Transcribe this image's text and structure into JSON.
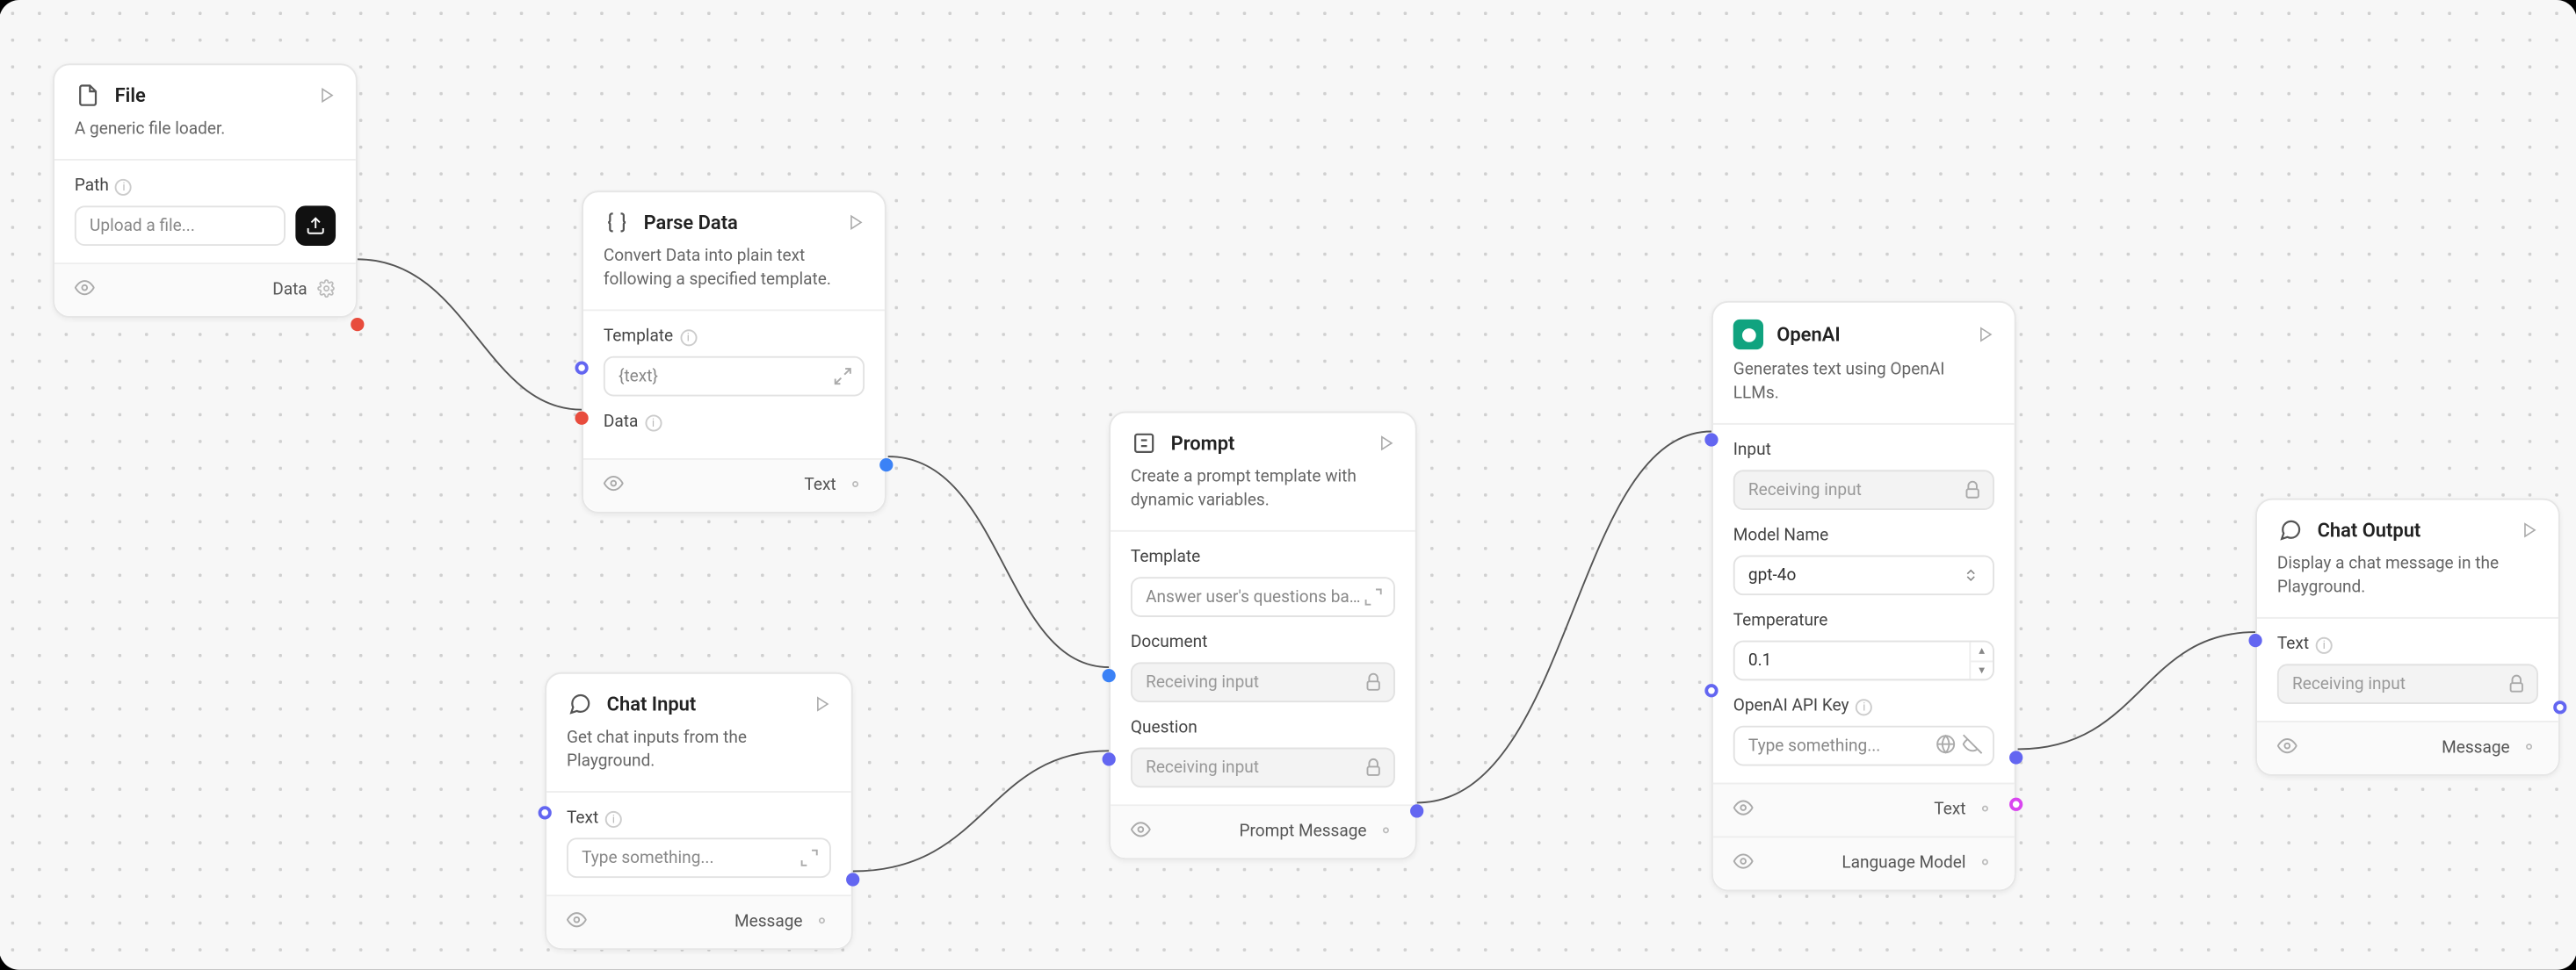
{
  "nodes": {
    "file": {
      "title": "File",
      "desc": "A generic file loader.",
      "path_label": "Path",
      "path_placeholder": "Upload a file...",
      "output_label": "Data"
    },
    "parse": {
      "title": "Parse Data",
      "desc": "Convert Data into plain text following a specified template.",
      "template_label": "Template",
      "template_value": "{text}",
      "data_label": "Data",
      "output_label": "Text"
    },
    "chat_input": {
      "title": "Chat Input",
      "desc": "Get chat inputs from the Playground.",
      "text_label": "Text",
      "text_placeholder": "Type something...",
      "output_label": "Message"
    },
    "prompt": {
      "title": "Prompt",
      "desc": "Create a prompt template with dynamic variables.",
      "template_label": "Template",
      "template_value": "Answer user's questions based on...",
      "document_label": "Document",
      "question_label": "Question",
      "receiving": "Receiving input",
      "output_label": "Prompt Message"
    },
    "openai": {
      "title": "OpenAI",
      "desc": "Generates text using OpenAI LLMs.",
      "input_label": "Input",
      "receiving": "Receiving input",
      "model_label": "Model Name",
      "model_value": "gpt-4o",
      "temp_label": "Temperature",
      "temp_value": "0.1",
      "apikey_label": "OpenAI API Key",
      "apikey_placeholder": "Type something...",
      "out_text": "Text",
      "out_lm": "Language Model"
    },
    "chat_output": {
      "title": "Chat Output",
      "desc": "Display a chat message in the Playground.",
      "text_label": "Text",
      "receiving": "Receiving input",
      "output_label": "Message"
    }
  }
}
